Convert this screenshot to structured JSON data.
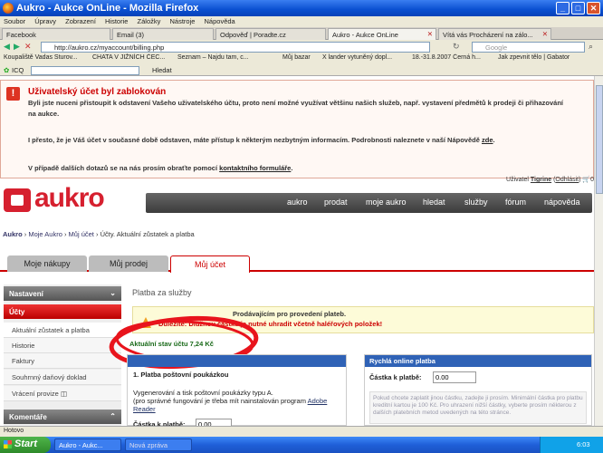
{
  "window": {
    "title": "Aukro - Aukce OnLine - Mozilla Firefox"
  },
  "menu": [
    "Soubor",
    "Úpravy",
    "Zobrazení",
    "Historie",
    "Záložky",
    "Nástroje",
    "Nápověda"
  ],
  "tabs": [
    "Facebook",
    "Email (3)",
    "Odpověď | Poradte.cz",
    "Aukro - Aukce OnLine",
    "Vítá vás Procházení na zálo..."
  ],
  "url": "http://aukro.cz/myaccount/billing.php",
  "search_placeholder": "Google",
  "bookmarks": [
    "Koupaliště Vadas Sturov...",
    "CHATA V JIŽNÍCH ČEC...",
    "Seznam – Najdu tam, c...",
    "Můj bazar",
    "X lander vytuněný dopl...",
    "18.-31.8.2007 Černá h...",
    "Jak zpevnit tělo | Gabator"
  ],
  "icq": {
    "label": "ICQ",
    "search": "Hledat"
  },
  "notice": {
    "title": "Uživatelský účet byl zablokován",
    "p1": "Byli jste nuceni přistoupit k odstavení Vašeho uživatelského účtu, proto není možné využívat většinu našich služeb, např. vystavení předmětů k prodeji či přihazování na aukce.",
    "p2a": "I přesto, že je Váš účet v současné době odstaven, máte přístup k některým nezbytným informacím. Podrobnosti naleznete v naší Nápovědě",
    "p2link": "zde",
    "p3a": "V případě dalších dotazů se na nás prosím obraťte pomocí",
    "p3link": "kontaktního formuláře"
  },
  "user": {
    "label": "Uživatel",
    "name": "Tigrine",
    "logout": "Odhlásit",
    "cart": "0"
  },
  "logo": "aukro",
  "mainnav": [
    "aukro",
    "prodat",
    "moje aukro",
    "hledat",
    "služby",
    "fórum",
    "nápověda"
  ],
  "breadcrumb": {
    "a": "Aukro",
    "b": "Moje Aukro",
    "c": "Můj účet",
    "d": "Účty. Aktuální zůstatek a platba"
  },
  "pagetabs": [
    "Moje nákupy",
    "Můj prodej",
    "Můj účet"
  ],
  "sidebar": {
    "nastaveni": "Nastavení",
    "ucty": "Účty",
    "items": [
      "Aktuální zůstatek a platba",
      "Historie",
      "Faktury",
      "Souhrnný daňový doklad",
      "Vrácení provize"
    ],
    "komentare": "Komentáře"
  },
  "content": {
    "heading": "Platba za služby",
    "alert1": "Prodávajícím pro provedení plateb.",
    "alert2": "Důležité: Dlužnou částku je nutné uhradit včetně haléřových položek!",
    "balance": "Aktuální stav účtu 7,24 Kč",
    "left_title": "1. Platba poštovní poukázkou",
    "left_text": "Vygenerování a tisk poštovní poukázky typu A.",
    "left_text2": "(pro správné fungování je třeba mít nainstalován program",
    "left_link": "Adobe Reader",
    "amount_label": "Částka k platbě:",
    "amount_value": "0.00",
    "right_title": "Rychlá online platba",
    "right_amount_label": "Částka k platbě:",
    "right_amount_value": "0.00",
    "right_note": "Pokud chcete zaplatit jinou částku, zadejte ji prosím. Minimální částka pro platbu kreditní kartou je 100 Kč. Pro uhrazení nižší částky, vyberte prosím některou z dalších platebních metod uvedených na této stránce."
  },
  "status": "Hotovo",
  "taskbar": {
    "start": "Start",
    "task1": "Aukro - Aukc...",
    "task2": "Nová zpráva",
    "clock": "6:03"
  }
}
